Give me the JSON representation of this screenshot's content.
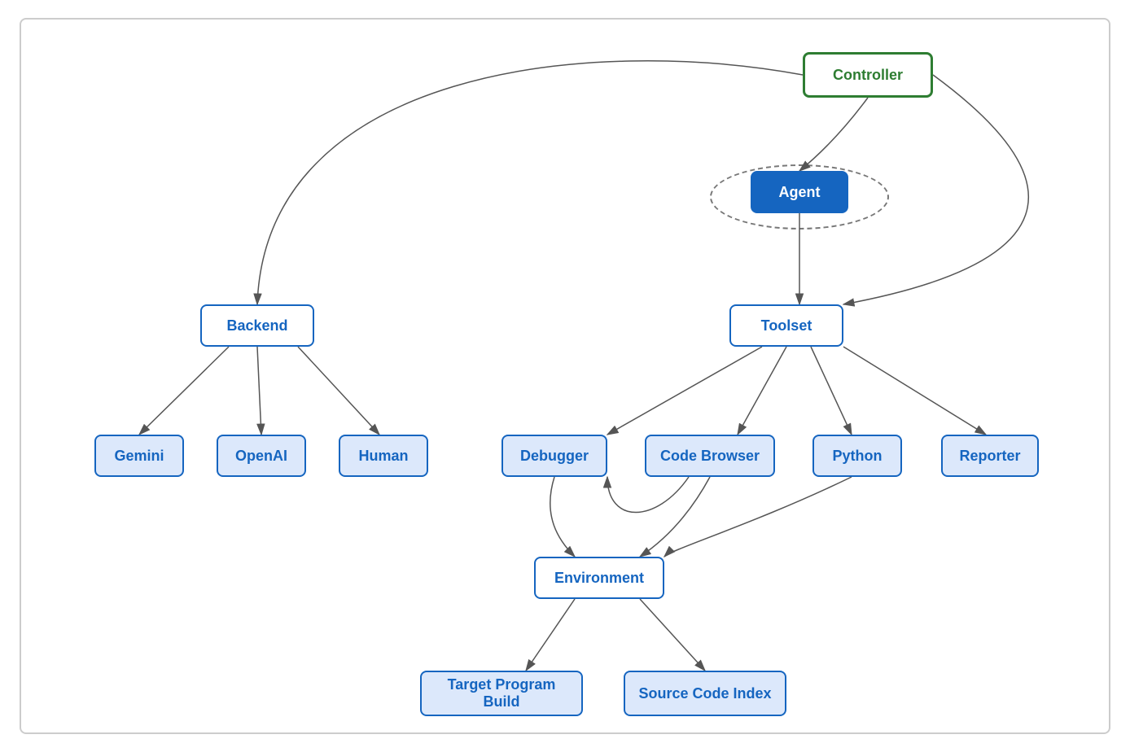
{
  "nodes": {
    "controller": {
      "label": "Controller"
    },
    "agent": {
      "label": "Agent"
    },
    "backend": {
      "label": "Backend"
    },
    "toolset": {
      "label": "Toolset"
    },
    "gemini": {
      "label": "Gemini"
    },
    "openai": {
      "label": "OpenAI"
    },
    "human": {
      "label": "Human"
    },
    "debugger": {
      "label": "Debugger"
    },
    "codebrowser": {
      "label": "Code Browser"
    },
    "python": {
      "label": "Python"
    },
    "reporter": {
      "label": "Reporter"
    },
    "environment": {
      "label": "Environment"
    },
    "targetbuild": {
      "label": "Target Program Build"
    },
    "sourcecode": {
      "label": "Source Code Index"
    }
  },
  "colors": {
    "controller_border": "#2e7d32",
    "controller_text": "#2e7d32",
    "agent_bg": "#1565c0",
    "blue_border": "#1565c0",
    "light_blue_bg": "#dce8fb",
    "arrow": "#555"
  }
}
